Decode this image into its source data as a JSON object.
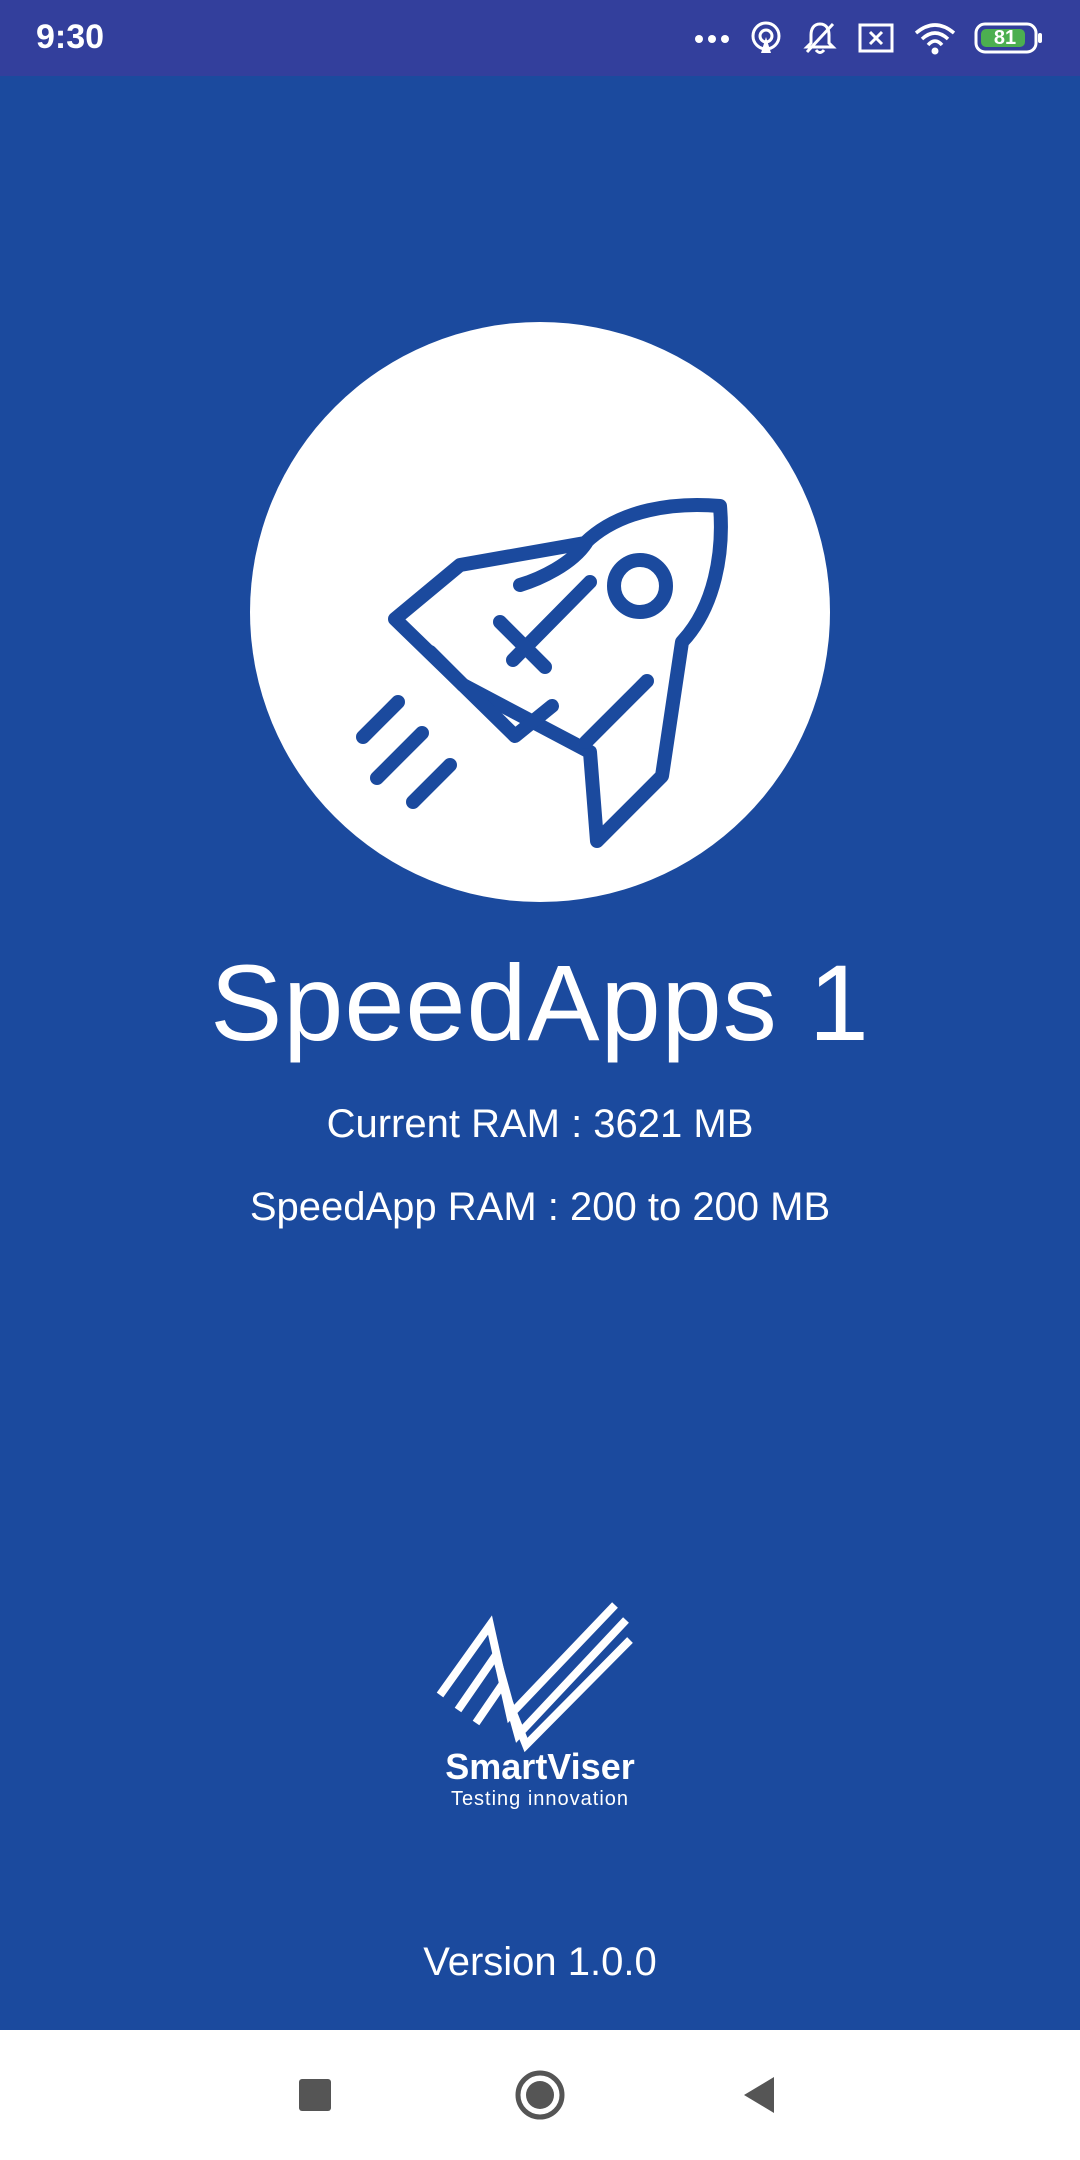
{
  "status_bar": {
    "time": "9:30",
    "battery_level": "81",
    "icons": [
      "more-dots-icon",
      "hotspot-icon",
      "bell-off-icon",
      "sim-x-icon",
      "wifi-icon",
      "battery-icon"
    ],
    "battery_color": "#4CAF50"
  },
  "app": {
    "title": "SpeedApps 1",
    "current_ram": "Current RAM : 3621 MB",
    "speedapp_ram": "SpeedApp RAM : 200 to 200 MB",
    "logo_icon": "rocket-icon"
  },
  "brand": {
    "name": "SmartViser",
    "tagline": "Testing innovation",
    "logo_icon": "smartviser-logo-icon"
  },
  "footer": {
    "version": "Version 1.0.0"
  },
  "nav_bar": {
    "buttons": [
      "recents-icon",
      "home-icon",
      "back-icon"
    ]
  },
  "colors": {
    "background": "#1B4A9E",
    "status_bar": "#333F9C",
    "nav_bar": "#FFFFFF",
    "text": "#FFFFFF"
  }
}
